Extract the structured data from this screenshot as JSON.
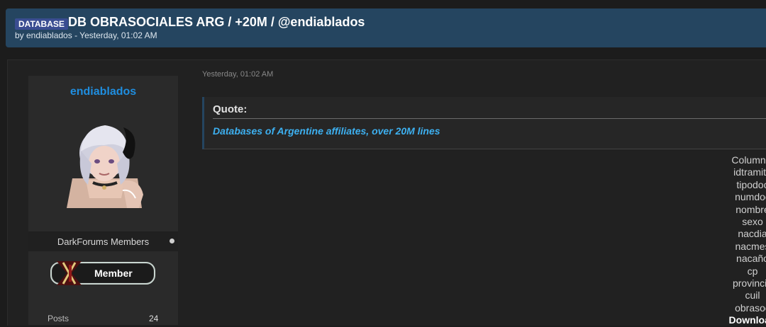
{
  "thread": {
    "tag": "DATABASE",
    "title": "DB OBRASOCIALES ARG / +20M / @endiablados",
    "byline": "by endiablados - Yesterday, 01:02 AM"
  },
  "author": {
    "username": "endiablados",
    "group": "DarkForums Members",
    "rank": "Member",
    "posts_label": "Posts",
    "posts_value": "24"
  },
  "post": {
    "date": "Yesterday, 01:02 AM",
    "quote_label": "Quote:",
    "quote_text": "Databases of Argentine affiliates, over 20M lines",
    "columns": [
      "Columns:",
      "idtramite",
      "tipodoc",
      "numdoc",
      "nombre",
      "sexo",
      "nacdia",
      "nacmes",
      "nacaño",
      "cp",
      "provincia",
      "cuil",
      "obrasoc"
    ],
    "download_label": "Download"
  },
  "colors": {
    "header_bg": "#254560",
    "tag_bg": "#3a4d91",
    "username": "#1f8ee0",
    "quote_text": "#3db0f0"
  },
  "icons": {
    "avatar": "anime-avatar",
    "rank": "member-rank-badge",
    "status": "status-dot"
  }
}
